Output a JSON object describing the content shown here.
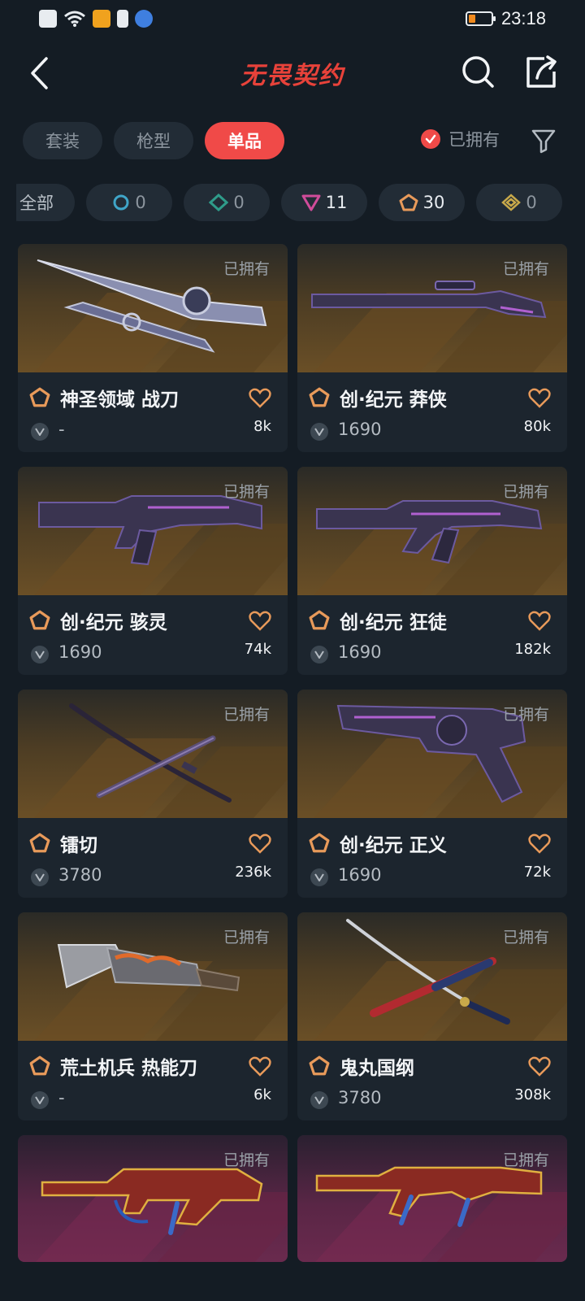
{
  "status_bar": {
    "time": "23:18",
    "battery_level": 0.3
  },
  "header": {
    "title": "无畏契约"
  },
  "tabs": [
    {
      "label": "套装",
      "active": false
    },
    {
      "label": "枪型",
      "active": false
    },
    {
      "label": "单品",
      "active": true
    }
  ],
  "owned_filter": {
    "label": "已拥有",
    "checked": true
  },
  "tiers": [
    {
      "label": "全部",
      "color": "#b9c0c7"
    },
    {
      "count": "0",
      "color": "#3fa5c8"
    },
    {
      "count": "0",
      "color": "#2f9c8a"
    },
    {
      "count": "11",
      "color": "#d04c9a"
    },
    {
      "count": "30",
      "color": "#e89a5a"
    },
    {
      "count": "0",
      "color": "#c8a94a"
    }
  ],
  "items": [
    {
      "name": "神圣领域 战刀",
      "price": "-",
      "likes": "8k",
      "owned": "已拥有"
    },
    {
      "name": "创·纪元 莽侠",
      "price": "1690",
      "likes": "80k",
      "owned": "已拥有"
    },
    {
      "name": "创·纪元 骇灵",
      "price": "1690",
      "likes": "74k",
      "owned": "已拥有"
    },
    {
      "name": "创·纪元 狂徒",
      "price": "1690",
      "likes": "182k",
      "owned": "已拥有"
    },
    {
      "name": "镭切",
      "price": "3780",
      "likes": "236k",
      "owned": "已拥有"
    },
    {
      "name": "创·纪元 正义",
      "price": "1690",
      "likes": "72k",
      "owned": "已拥有"
    },
    {
      "name": "荒土机兵 热能刀",
      "price": "-",
      "likes": "6k",
      "owned": "已拥有"
    },
    {
      "name": "鬼丸国纲",
      "price": "3780",
      "likes": "308k",
      "owned": "已拥有"
    },
    {
      "owned": "已拥有"
    },
    {
      "owned": "已拥有"
    }
  ],
  "colors": {
    "accent": "#f04a48",
    "tier_exclusive": "#e89a5a"
  }
}
